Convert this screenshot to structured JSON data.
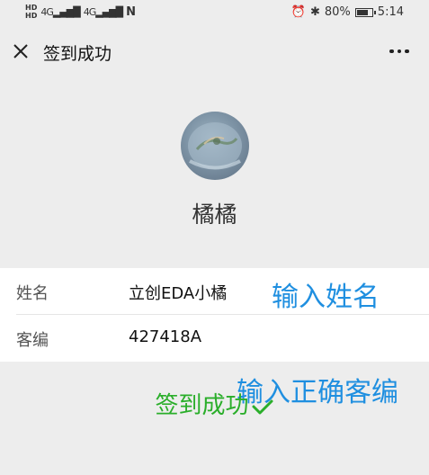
{
  "status_bar": {
    "hd1": "HD",
    "hd2": "HD",
    "net1": "4G",
    "net2": "4G",
    "nfc": "N",
    "battery_text": "80%",
    "battery_level": 0.8,
    "time": "5:14"
  },
  "nav": {
    "title": "签到成功"
  },
  "profile": {
    "nickname": "橘橘"
  },
  "form": {
    "rows": [
      {
        "label": "姓名",
        "value": "立创EDA小橘"
      },
      {
        "label": "客编",
        "value": "427418A"
      }
    ]
  },
  "annotations": {
    "name_hint": "输入姓名",
    "code_hint": "输入正确客编"
  },
  "result": {
    "message": "签到成功"
  },
  "colors": {
    "background": "#ededed",
    "success_green": "#2aae2a",
    "annotation_blue": "#1f8fe0"
  }
}
